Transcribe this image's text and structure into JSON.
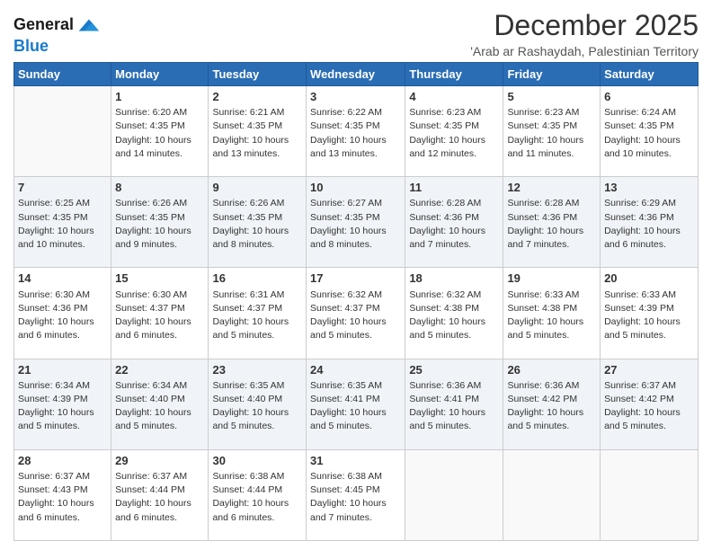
{
  "logo": {
    "line1": "General",
    "line2": "Blue"
  },
  "title": "December 2025",
  "subtitle": "'Arab ar Rashaydah, Palestinian Territory",
  "days_header": [
    "Sunday",
    "Monday",
    "Tuesday",
    "Wednesday",
    "Thursday",
    "Friday",
    "Saturday"
  ],
  "weeks": [
    [
      {
        "num": "",
        "info": ""
      },
      {
        "num": "1",
        "info": "Sunrise: 6:20 AM\nSunset: 4:35 PM\nDaylight: 10 hours\nand 14 minutes."
      },
      {
        "num": "2",
        "info": "Sunrise: 6:21 AM\nSunset: 4:35 PM\nDaylight: 10 hours\nand 13 minutes."
      },
      {
        "num": "3",
        "info": "Sunrise: 6:22 AM\nSunset: 4:35 PM\nDaylight: 10 hours\nand 13 minutes."
      },
      {
        "num": "4",
        "info": "Sunrise: 6:23 AM\nSunset: 4:35 PM\nDaylight: 10 hours\nand 12 minutes."
      },
      {
        "num": "5",
        "info": "Sunrise: 6:23 AM\nSunset: 4:35 PM\nDaylight: 10 hours\nand 11 minutes."
      },
      {
        "num": "6",
        "info": "Sunrise: 6:24 AM\nSunset: 4:35 PM\nDaylight: 10 hours\nand 10 minutes."
      }
    ],
    [
      {
        "num": "7",
        "info": "Sunrise: 6:25 AM\nSunset: 4:35 PM\nDaylight: 10 hours\nand 10 minutes."
      },
      {
        "num": "8",
        "info": "Sunrise: 6:26 AM\nSunset: 4:35 PM\nDaylight: 10 hours\nand 9 minutes."
      },
      {
        "num": "9",
        "info": "Sunrise: 6:26 AM\nSunset: 4:35 PM\nDaylight: 10 hours\nand 8 minutes."
      },
      {
        "num": "10",
        "info": "Sunrise: 6:27 AM\nSunset: 4:35 PM\nDaylight: 10 hours\nand 8 minutes."
      },
      {
        "num": "11",
        "info": "Sunrise: 6:28 AM\nSunset: 4:36 PM\nDaylight: 10 hours\nand 7 minutes."
      },
      {
        "num": "12",
        "info": "Sunrise: 6:28 AM\nSunset: 4:36 PM\nDaylight: 10 hours\nand 7 minutes."
      },
      {
        "num": "13",
        "info": "Sunrise: 6:29 AM\nSunset: 4:36 PM\nDaylight: 10 hours\nand 6 minutes."
      }
    ],
    [
      {
        "num": "14",
        "info": "Sunrise: 6:30 AM\nSunset: 4:36 PM\nDaylight: 10 hours\nand 6 minutes."
      },
      {
        "num": "15",
        "info": "Sunrise: 6:30 AM\nSunset: 4:37 PM\nDaylight: 10 hours\nand 6 minutes."
      },
      {
        "num": "16",
        "info": "Sunrise: 6:31 AM\nSunset: 4:37 PM\nDaylight: 10 hours\nand 5 minutes."
      },
      {
        "num": "17",
        "info": "Sunrise: 6:32 AM\nSunset: 4:37 PM\nDaylight: 10 hours\nand 5 minutes."
      },
      {
        "num": "18",
        "info": "Sunrise: 6:32 AM\nSunset: 4:38 PM\nDaylight: 10 hours\nand 5 minutes."
      },
      {
        "num": "19",
        "info": "Sunrise: 6:33 AM\nSunset: 4:38 PM\nDaylight: 10 hours\nand 5 minutes."
      },
      {
        "num": "20",
        "info": "Sunrise: 6:33 AM\nSunset: 4:39 PM\nDaylight: 10 hours\nand 5 minutes."
      }
    ],
    [
      {
        "num": "21",
        "info": "Sunrise: 6:34 AM\nSunset: 4:39 PM\nDaylight: 10 hours\nand 5 minutes."
      },
      {
        "num": "22",
        "info": "Sunrise: 6:34 AM\nSunset: 4:40 PM\nDaylight: 10 hours\nand 5 minutes."
      },
      {
        "num": "23",
        "info": "Sunrise: 6:35 AM\nSunset: 4:40 PM\nDaylight: 10 hours\nand 5 minutes."
      },
      {
        "num": "24",
        "info": "Sunrise: 6:35 AM\nSunset: 4:41 PM\nDaylight: 10 hours\nand 5 minutes."
      },
      {
        "num": "25",
        "info": "Sunrise: 6:36 AM\nSunset: 4:41 PM\nDaylight: 10 hours\nand 5 minutes."
      },
      {
        "num": "26",
        "info": "Sunrise: 6:36 AM\nSunset: 4:42 PM\nDaylight: 10 hours\nand 5 minutes."
      },
      {
        "num": "27",
        "info": "Sunrise: 6:37 AM\nSunset: 4:42 PM\nDaylight: 10 hours\nand 5 minutes."
      }
    ],
    [
      {
        "num": "28",
        "info": "Sunrise: 6:37 AM\nSunset: 4:43 PM\nDaylight: 10 hours\nand 6 minutes."
      },
      {
        "num": "29",
        "info": "Sunrise: 6:37 AM\nSunset: 4:44 PM\nDaylight: 10 hours\nand 6 minutes."
      },
      {
        "num": "30",
        "info": "Sunrise: 6:38 AM\nSunset: 4:44 PM\nDaylight: 10 hours\nand 6 minutes."
      },
      {
        "num": "31",
        "info": "Sunrise: 6:38 AM\nSunset: 4:45 PM\nDaylight: 10 hours\nand 7 minutes."
      },
      {
        "num": "",
        "info": ""
      },
      {
        "num": "",
        "info": ""
      },
      {
        "num": "",
        "info": ""
      }
    ]
  ]
}
